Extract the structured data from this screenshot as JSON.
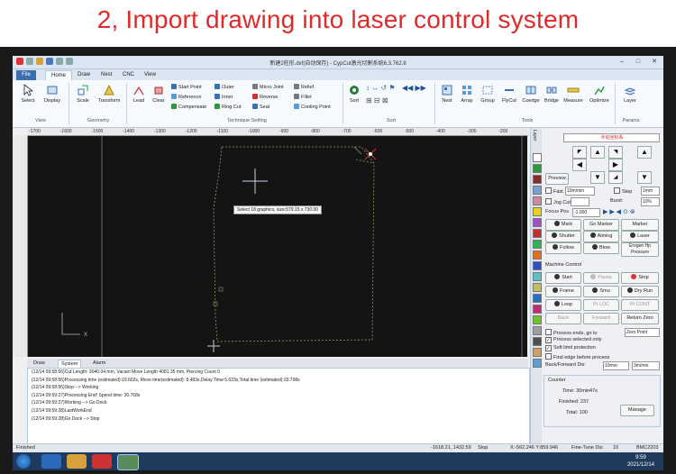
{
  "banner": {
    "title": "2, Import drawing into laser control system"
  },
  "window": {
    "title": "新建2柱形.dxf(自动保存) - CypCut激光切割系统6.3.762.8"
  },
  "tabs": [
    "File",
    "Home",
    "Draw",
    "Nest",
    "CNC",
    "View"
  ],
  "ribbon": {
    "select": "Select",
    "display": "Display",
    "view_group": "View",
    "scale": "Scale",
    "transform": "Transform",
    "geometry_group": "Geometry",
    "lead": "Lead",
    "clear": "Clear",
    "start_point": "Start Point",
    "reference": "Reference",
    "compensate": "Compensate",
    "outer": "Outer",
    "inner": "Inner",
    "ring_cut": "Ring Cut",
    "micro_joint": "Micro Joint",
    "reverse": "Reverse",
    "seal": "Seal",
    "relief": "Relief",
    "fillet": "Fillet",
    "cooling_point": "Cooling Point",
    "technique_group": "Technique Setting",
    "sort": "Sort",
    "sort_group": "Sort",
    "nest": "Nest",
    "array": "Array",
    "group": "Group",
    "flycut": "FlyCut",
    "coedge": "Coedge",
    "bridge": "Bridge",
    "measure": "Measure",
    "optimize": "Optimize",
    "tools_group": "Tools",
    "layer": "Layer",
    "params_group": "Params"
  },
  "ruler": {
    "ticks": [
      "-1700",
      "-1600",
      "-1500",
      "-1400",
      "-1300",
      "-1200",
      "-1100",
      "-1000",
      "-900",
      "-800",
      "-700",
      "-600",
      "-500",
      "-400",
      "-300",
      "-200"
    ]
  },
  "canvas": {
    "tooltip": "Select 18 graphics, size:579.15 x 730.00"
  },
  "panel": {
    "coord_select": "手动坐标系",
    "preview": "Preview",
    "fast": "Fast",
    "fast_speed": "10m/min",
    "step": "Step",
    "step_val": "1mm",
    "jog_cut": "Jog Cut",
    "burst": "Burst:",
    "burst_val": "10%",
    "focus_pos": "Focus Pos",
    "focus_val": "-1.000",
    "mark": "Mark",
    "go_marker": "Go Marker",
    "marker": "Marker",
    "shutter": "Shutter",
    "aiming": "Aiming",
    "laser": "Laser",
    "follow": "Follow",
    "blow": "Blow",
    "erogen": "Erogen Hp Pressure",
    "machine_control": "Machine Control",
    "start": "Start",
    "pause": "Pause",
    "stop": "Stop",
    "frame": "Frame",
    "smu": "Smu",
    "dry_run": "Dry Run",
    "loop": "Loop",
    "pt_loc": "Pt LOC",
    "pt_cont": "Pt CONT",
    "back": "Back",
    "forward": "Forward",
    "return_zero": "Return Zero",
    "process_ends": "Process ends, go to",
    "zero_point": "Zero Point",
    "process_selected": "Process selected only",
    "soft_limit": "Soft limit protection",
    "find_edge": "Find edge before process",
    "back_forward_dis": "Back/Forward Dis:",
    "bf_dis": "10mm",
    "bf_speed": "3m/min",
    "counter": "Counter",
    "time": "Time: 30min47s",
    "finished": "Finished: 237",
    "total": "Total: 100",
    "manage": "Manage"
  },
  "bottom_tabs": [
    "Draw",
    "System",
    "Alarm"
  ],
  "log": [
    "(12/14 09:58:56)Cut Length: 3040.04 mm, Vacant Move Length 4081.35 mm, Piercing Count 0",
    "(12/14 09:58:56)Processing time (estimated):19.602s, Move time(estimated): 8.483s,Delay Time:5.623s,Total time (estimated):33.708s",
    "(12/14 09:58:56)Stop --> Working",
    "(12/14 09:59:27)Processing End! Spend time: 30.768s",
    "(12/14 09:59:27)Working --> Go Dock",
    "(12/14 09:59:28)LastWorkEnd",
    "(12/14 09:59:28)Go Dock --> Stop"
  ],
  "status": {
    "left": "Finished",
    "coords": "-1618.21, 1432.59",
    "state": "Stop",
    "machine": "X:-562.246 Y:859.946",
    "fine_tune": "Fine-Tune Dis:",
    "fine_val": "10",
    "card": "BMC2203"
  },
  "clock": {
    "time": "9:59",
    "date": "2021/12/14"
  }
}
